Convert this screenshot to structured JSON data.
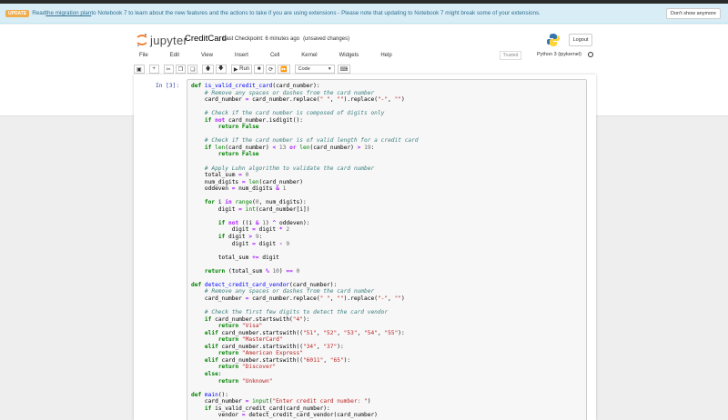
{
  "banner": {
    "badge": "UPDATE",
    "text_before": "Read ",
    "link": "the migration plan",
    "text_after": " to Notebook 7 to learn about the new features and the actions to take if you are using extensions - Please note that updating to Notebook 7 might break some of your extensions.",
    "dismiss": "Don't show anymore"
  },
  "header": {
    "logo_text": "jupyter",
    "notebook_name": "CreditCard",
    "checkpoint": "Last Checkpoint: 6 minutes ago",
    "unsaved": "(unsaved changes)",
    "logout": "Logout",
    "trusted": "Trusted",
    "kernel": "Python 3 (ipykernel)"
  },
  "menu": [
    "File",
    "Edit",
    "View",
    "Insert",
    "Cell",
    "Kernel",
    "Widgets",
    "Help"
  ],
  "toolbar": {
    "run_label": "Run",
    "cell_type": "Code"
  },
  "cell": {
    "prompt": "In [3]:"
  },
  "colors": {
    "keyword": "#008000",
    "function": "#0000ff",
    "comment": "#408080",
    "string": "#ba2121",
    "number": "#666666",
    "operator": "#aa22ff",
    "banner_bg": "#d9edf7",
    "prompt": "#303f9f"
  },
  "code_lines": [
    [
      [
        "kw",
        "def "
      ],
      [
        "fn",
        "is_valid_credit_card"
      ],
      [
        "",
        "(card_number):"
      ]
    ],
    [
      [
        "",
        "    "
      ],
      [
        "cm",
        "# Remove any spaces or dashes from the card number"
      ]
    ],
    [
      [
        "",
        "    card_number "
      ],
      [
        "op",
        "="
      ],
      [
        "",
        " card_number.replace("
      ],
      [
        "st",
        "\" \""
      ],
      [
        "",
        ", "
      ],
      [
        "st",
        "\"\""
      ],
      [
        "",
        ").replace("
      ],
      [
        "st",
        "\"-\""
      ],
      [
        "",
        ", "
      ],
      [
        "st",
        "\"\""
      ],
      [
        "",
        ")"
      ]
    ],
    [
      [
        "",
        ""
      ]
    ],
    [
      [
        "",
        "    "
      ],
      [
        "cm",
        "# Check if the card number is composed of digits only"
      ]
    ],
    [
      [
        "",
        "    "
      ],
      [
        "kw",
        "if "
      ],
      [
        "op",
        "not"
      ],
      [
        "",
        " card_number.isdigit():"
      ]
    ],
    [
      [
        "",
        "        "
      ],
      [
        "kw",
        "return "
      ],
      [
        "kw",
        "False"
      ]
    ],
    [
      [
        "",
        ""
      ]
    ],
    [
      [
        "",
        "    "
      ],
      [
        "cm",
        "# Check if the card number is of valid length for a credit card"
      ]
    ],
    [
      [
        "",
        "    "
      ],
      [
        "kw",
        "if "
      ],
      [
        "bi",
        "len"
      ],
      [
        "",
        "(card_number) "
      ],
      [
        "op",
        "<"
      ],
      [
        "",
        " "
      ],
      [
        "nu",
        "13"
      ],
      [
        "",
        " "
      ],
      [
        "op",
        "or"
      ],
      [
        "",
        " "
      ],
      [
        "bi",
        "len"
      ],
      [
        "",
        "(card_number) "
      ],
      [
        "op",
        ">"
      ],
      [
        "",
        " "
      ],
      [
        "nu",
        "19"
      ],
      [
        "",
        ":"
      ]
    ],
    [
      [
        "",
        "        "
      ],
      [
        "kw",
        "return "
      ],
      [
        "kw",
        "False"
      ]
    ],
    [
      [
        "",
        ""
      ]
    ],
    [
      [
        "",
        "    "
      ],
      [
        "cm",
        "# Apply Luhn algorithm to validate the card number"
      ]
    ],
    [
      [
        "",
        "    total_sum "
      ],
      [
        "op",
        "="
      ],
      [
        "",
        " "
      ],
      [
        "nu",
        "0"
      ]
    ],
    [
      [
        "",
        "    num_digits "
      ],
      [
        "op",
        "="
      ],
      [
        "",
        " "
      ],
      [
        "bi",
        "len"
      ],
      [
        "",
        "(card_number)"
      ]
    ],
    [
      [
        "",
        "    oddeven "
      ],
      [
        "op",
        "="
      ],
      [
        "",
        " num_digits "
      ],
      [
        "op",
        "&"
      ],
      [
        "",
        " "
      ],
      [
        "nu",
        "1"
      ]
    ],
    [
      [
        "",
        ""
      ]
    ],
    [
      [
        "",
        "    "
      ],
      [
        "kw",
        "for "
      ],
      [
        "",
        "i "
      ],
      [
        "op",
        "in"
      ],
      [
        "",
        " "
      ],
      [
        "bi",
        "range"
      ],
      [
        "",
        "("
      ],
      [
        "nu",
        "0"
      ],
      [
        "",
        ", num_digits):"
      ]
    ],
    [
      [
        "",
        "        digit "
      ],
      [
        "op",
        "="
      ],
      [
        "",
        " "
      ],
      [
        "bi",
        "int"
      ],
      [
        "",
        "(card_number[i])"
      ]
    ],
    [
      [
        "",
        ""
      ]
    ],
    [
      [
        "",
        "        "
      ],
      [
        "kw",
        "if "
      ],
      [
        "op",
        "not"
      ],
      [
        "",
        " ((i "
      ],
      [
        "op",
        "&"
      ],
      [
        "",
        " "
      ],
      [
        "nu",
        "1"
      ],
      [
        "",
        ") "
      ],
      [
        "op",
        "^"
      ],
      [
        "",
        " oddeven):"
      ]
    ],
    [
      [
        "",
        "            digit "
      ],
      [
        "op",
        "="
      ],
      [
        "",
        " digit "
      ],
      [
        "op",
        "*"
      ],
      [
        "",
        " "
      ],
      [
        "nu",
        "2"
      ]
    ],
    [
      [
        "",
        "        "
      ],
      [
        "kw",
        "if "
      ],
      [
        "",
        "digit "
      ],
      [
        "op",
        ">"
      ],
      [
        "",
        " "
      ],
      [
        "nu",
        "9"
      ],
      [
        "",
        ":"
      ]
    ],
    [
      [
        "",
        "            digit "
      ],
      [
        "op",
        "="
      ],
      [
        "",
        " digit "
      ],
      [
        "op",
        "-"
      ],
      [
        "",
        " "
      ],
      [
        "nu",
        "9"
      ]
    ],
    [
      [
        "",
        ""
      ]
    ],
    [
      [
        "",
        "        total_sum "
      ],
      [
        "op",
        "+="
      ],
      [
        "",
        " digit"
      ]
    ],
    [
      [
        "",
        ""
      ]
    ],
    [
      [
        "",
        "    "
      ],
      [
        "kw",
        "return "
      ],
      [
        "",
        "(total_sum "
      ],
      [
        "op",
        "%"
      ],
      [
        "",
        " "
      ],
      [
        "nu",
        "10"
      ],
      [
        "",
        ") "
      ],
      [
        "op",
        "=="
      ],
      [
        "",
        " "
      ],
      [
        "nu",
        "0"
      ]
    ],
    [
      [
        "",
        ""
      ]
    ],
    [
      [
        "kw",
        "def "
      ],
      [
        "fn",
        "detect_credit_card_vendor"
      ],
      [
        "",
        "(card_number):"
      ]
    ],
    [
      [
        "",
        "    "
      ],
      [
        "cm",
        "# Remove any spaces or dashes from the card number"
      ]
    ],
    [
      [
        "",
        "    card_number "
      ],
      [
        "op",
        "="
      ],
      [
        "",
        " card_number.replace("
      ],
      [
        "st",
        "\" \""
      ],
      [
        "",
        ", "
      ],
      [
        "st",
        "\"\""
      ],
      [
        "",
        ").replace("
      ],
      [
        "st",
        "\"-\""
      ],
      [
        "",
        ", "
      ],
      [
        "st",
        "\"\""
      ],
      [
        "",
        ")"
      ]
    ],
    [
      [
        "",
        ""
      ]
    ],
    [
      [
        "",
        "    "
      ],
      [
        "cm",
        "# Check the first few digits to detect the card vendor"
      ]
    ],
    [
      [
        "",
        "    "
      ],
      [
        "kw",
        "if "
      ],
      [
        "",
        "card_number.startswith("
      ],
      [
        "st",
        "\"4\""
      ],
      [
        "",
        "):"
      ]
    ],
    [
      [
        "",
        "        "
      ],
      [
        "kw",
        "return "
      ],
      [
        "st",
        "\"Visa\""
      ]
    ],
    [
      [
        "",
        "    "
      ],
      [
        "kw",
        "elif "
      ],
      [
        "",
        "card_number.startswith(("
      ],
      [
        "st",
        "\"51\""
      ],
      [
        "",
        ", "
      ],
      [
        "st",
        "\"52\""
      ],
      [
        "",
        ", "
      ],
      [
        "st",
        "\"53\""
      ],
      [
        "",
        ", "
      ],
      [
        "st",
        "\"54\""
      ],
      [
        "",
        ", "
      ],
      [
        "st",
        "\"55\""
      ],
      [
        "",
        "):"
      ]
    ],
    [
      [
        "",
        "        "
      ],
      [
        "kw",
        "return "
      ],
      [
        "st",
        "\"MasterCard\""
      ]
    ],
    [
      [
        "",
        "    "
      ],
      [
        "kw",
        "elif "
      ],
      [
        "",
        "card_number.startswith(("
      ],
      [
        "st",
        "\"34\""
      ],
      [
        "",
        ", "
      ],
      [
        "st",
        "\"37\""
      ],
      [
        "",
        "):"
      ]
    ],
    [
      [
        "",
        "        "
      ],
      [
        "kw",
        "return "
      ],
      [
        "st",
        "\"American Express\""
      ]
    ],
    [
      [
        "",
        "    "
      ],
      [
        "kw",
        "elif "
      ],
      [
        "",
        "card_number.startswith(("
      ],
      [
        "st",
        "\"6011\""
      ],
      [
        "",
        ", "
      ],
      [
        "st",
        "\"65\""
      ],
      [
        "",
        "):"
      ]
    ],
    [
      [
        "",
        "        "
      ],
      [
        "kw",
        "return "
      ],
      [
        "st",
        "\"Discover\""
      ]
    ],
    [
      [
        "",
        "    "
      ],
      [
        "kw",
        "else"
      ],
      [
        "",
        ":"
      ]
    ],
    [
      [
        "",
        "        "
      ],
      [
        "kw",
        "return "
      ],
      [
        "st",
        "\"Unknown\""
      ]
    ],
    [
      [
        "",
        ""
      ]
    ],
    [
      [
        "kw",
        "def "
      ],
      [
        "fn",
        "main"
      ],
      [
        "",
        "():"
      ]
    ],
    [
      [
        "",
        "    card_number "
      ],
      [
        "op",
        "="
      ],
      [
        "",
        " "
      ],
      [
        "bi",
        "input"
      ],
      [
        "",
        "("
      ],
      [
        "st",
        "\"Enter credit card number: \""
      ],
      [
        "",
        ")"
      ]
    ],
    [
      [
        "",
        "    "
      ],
      [
        "kw",
        "if "
      ],
      [
        "",
        "is_valid_credit_card(card_number):"
      ]
    ],
    [
      [
        "",
        "        vendor "
      ],
      [
        "op",
        "="
      ],
      [
        "",
        " detect_credit_card_vendor(card_number)"
      ]
    ]
  ]
}
